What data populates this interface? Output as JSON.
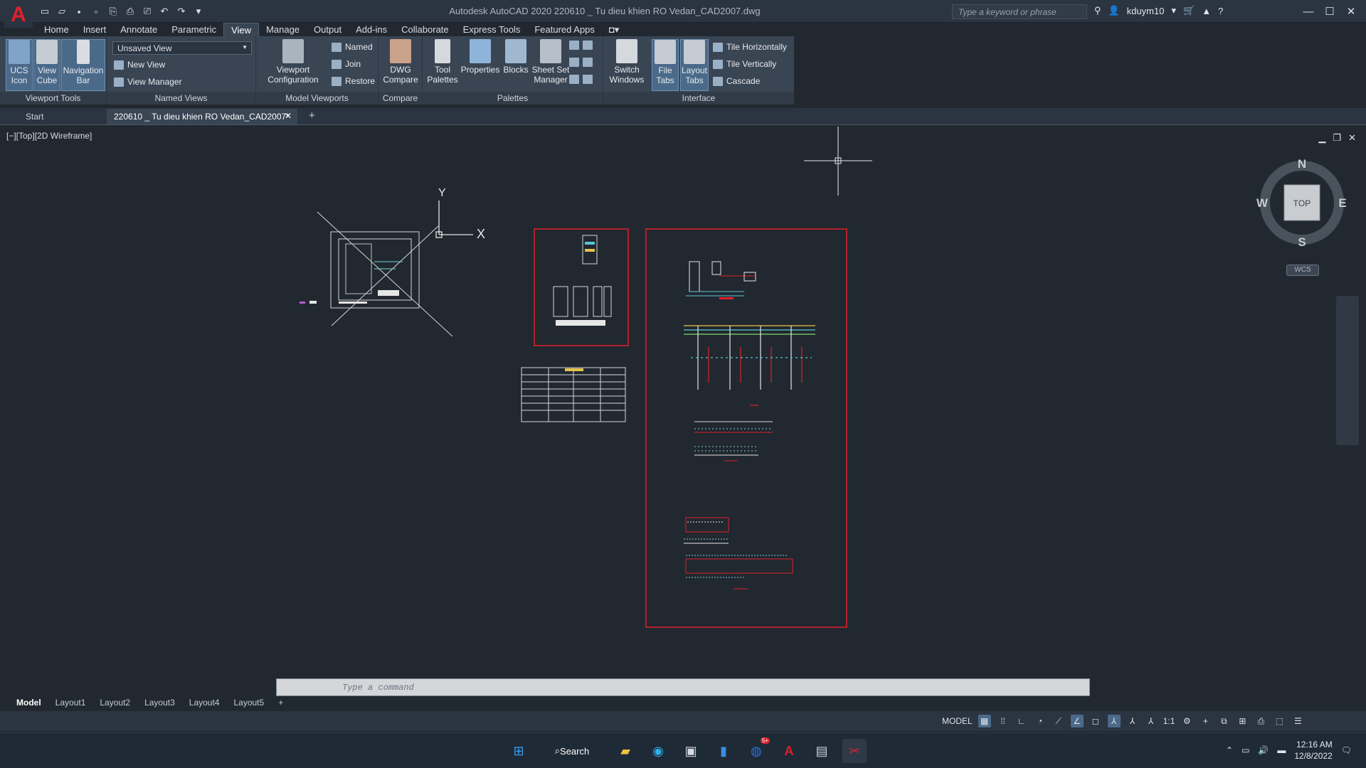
{
  "app": {
    "title": "Autodesk AutoCAD 2020   220610 _ Tu dieu khien RO Vedan_CAD2007.dwg",
    "logo": "A",
    "search_placeholder": "Type a keyword or phrase",
    "user": "kduym10"
  },
  "menu": {
    "tabs": [
      "Home",
      "Insert",
      "Annotate",
      "Parametric",
      "View",
      "Manage",
      "Output",
      "Add-ins",
      "Collaborate",
      "Express Tools",
      "Featured Apps"
    ],
    "active": "View"
  },
  "ribbon": {
    "viewport_tools": {
      "title": "Viewport Tools",
      "ucs": "UCS Icon",
      "viewcube": "View Cube",
      "navbar": "Navigation Bar"
    },
    "named_views": {
      "title": "Named Views",
      "dropdown": "Unsaved View",
      "new_view": "New View",
      "view_manager": "View Manager"
    },
    "model_viewports": {
      "title": "Model Viewports",
      "config": "Viewport Configuration",
      "named": "Named",
      "join": "Join",
      "restore": "Restore"
    },
    "compare": {
      "title": "Compare",
      "dwg": "DWG Compare"
    },
    "palettes": {
      "title": "Palettes",
      "tool": "Tool Palettes",
      "properties": "Properties",
      "blocks": "Blocks",
      "sheetset": "Sheet Set Manager"
    },
    "interface": {
      "title": "Interface",
      "switch": "Switch Windows",
      "filetabs": "File Tabs",
      "layouttabs": "Layout Tabs",
      "tile_h": "Tile Horizontally",
      "tile_v": "Tile Vertically",
      "cascade": "Cascade"
    }
  },
  "filetabs": {
    "start": "Start",
    "doc": "220610 _ Tu dieu khien RO Vedan_CAD2007*"
  },
  "viewport": {
    "label": "[−][Top][2D Wireframe]"
  },
  "viewcube": {
    "n": "N",
    "s": "S",
    "e": "E",
    "w": "W",
    "top": "TOP",
    "wcs": "WCS"
  },
  "ucs": {
    "x": "X",
    "y": "Y"
  },
  "command": {
    "placeholder": "Type a command"
  },
  "layouts": {
    "tabs": [
      "Model",
      "Layout1",
      "Layout2",
      "Layout3",
      "Layout4",
      "Layout5"
    ],
    "active": "Model"
  },
  "status": {
    "model": "MODEL",
    "scale": "1:1"
  },
  "taskbar": {
    "search": "Search",
    "time": "12:16 AM",
    "date": "12/8/2022",
    "badge": "5+"
  }
}
